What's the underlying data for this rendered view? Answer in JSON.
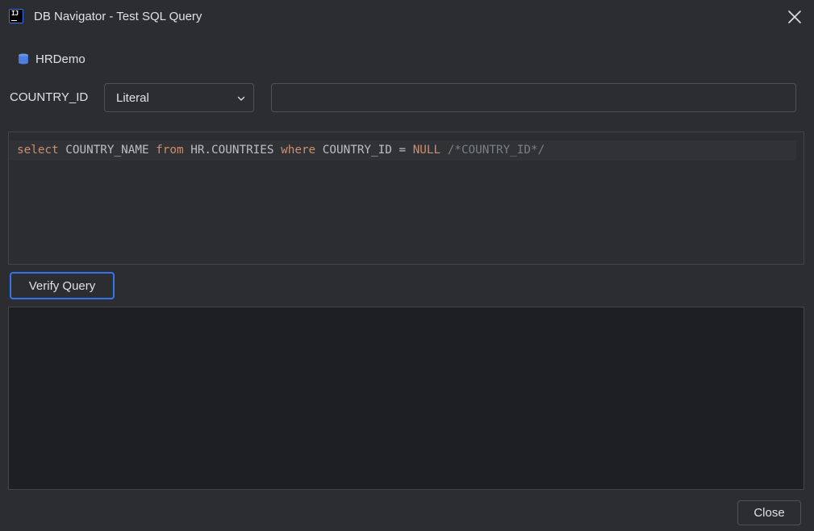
{
  "window": {
    "title": "DB Navigator - Test SQL Query",
    "app_icon": "intellij-icon",
    "close_icon": "close-icon"
  },
  "connection": {
    "icon": "database-icon",
    "name": "HRDemo"
  },
  "parameter": {
    "name": "COUNTRY_ID",
    "type_selected": "Literal",
    "value": "",
    "placeholder": ""
  },
  "editor": {
    "tokens": [
      {
        "text": "select",
        "kind": "kw"
      },
      {
        "text": " COUNTRY_NAME ",
        "kind": "id"
      },
      {
        "text": "from",
        "kind": "kw"
      },
      {
        "text": " HR.COUNTRIES ",
        "kind": "id"
      },
      {
        "text": "where",
        "kind": "kw"
      },
      {
        "text": " COUNTRY_ID = ",
        "kind": "id"
      },
      {
        "text": "NULL",
        "kind": "kw"
      },
      {
        "text": " /*COUNTRY_ID*/",
        "kind": "cm"
      }
    ]
  },
  "buttons": {
    "verify_label": "Verify Query",
    "close_label": "Close"
  },
  "colors": {
    "background": "#2b2d30",
    "keyword": "#cf8e6d",
    "comment": "#7a7e85",
    "accent": "#3574f0",
    "result_bg": "#1e1f22"
  }
}
